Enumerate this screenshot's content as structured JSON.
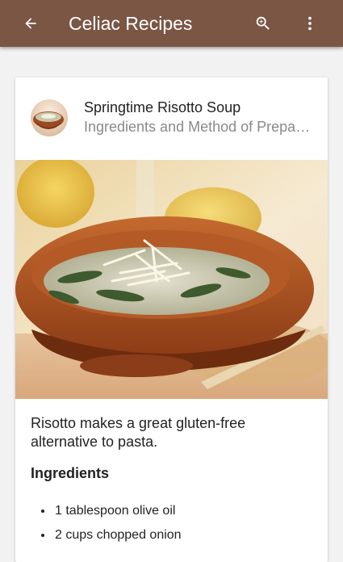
{
  "appbar": {
    "title": "Celiac Recipes",
    "background": "#7b5645",
    "icons": [
      "arrow-back-icon",
      "search-zoom-icon",
      "more-vert-icon"
    ]
  },
  "card": {
    "title": "Springtime Risotto Soup",
    "subtitle": "Ingredients and Method of Preparation",
    "description": "Risotto makes a great gluten-free alternative to pasta.",
    "ingredients_heading": "Ingredients",
    "ingredients": [
      "1 tablespoon olive oil",
      "2 cups chopped onion"
    ]
  }
}
